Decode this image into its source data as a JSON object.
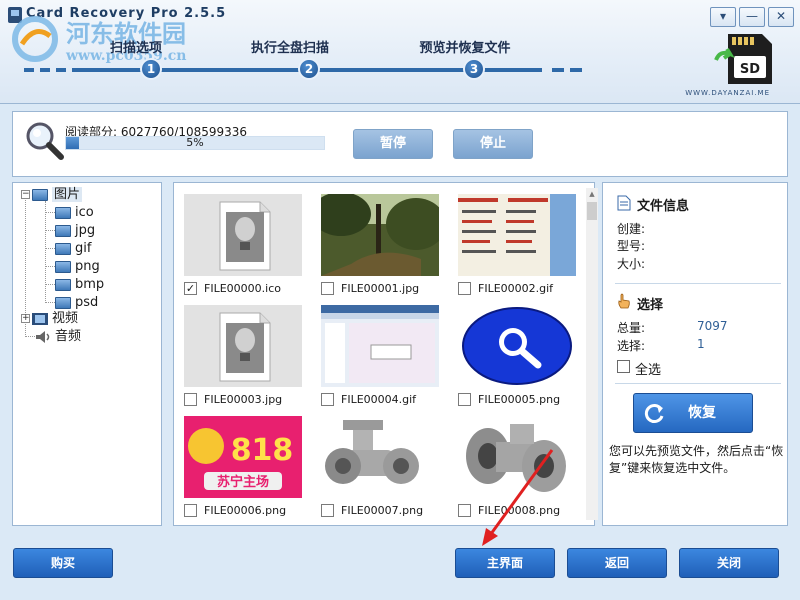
{
  "app": {
    "title": "Card Recovery Pro 2.5.5",
    "watermark_line1": "河东软件园",
    "watermark_line2": "www.pc0359.cn",
    "brand_site": "WWW.DAYANZAI.ME",
    "sd_label": "SD"
  },
  "window_controls": {
    "menu": "▾",
    "minimize": "—",
    "close": "✕"
  },
  "steps": [
    {
      "number": "1",
      "label": "扫描选项"
    },
    {
      "number": "2",
      "label": "执行全盘扫描"
    },
    {
      "number": "3",
      "label": "预览并恢复文件"
    }
  ],
  "scan": {
    "read_label": "阅读部分: 6027760/108599336",
    "progress_text": "5%",
    "progress_value": 0.05,
    "pause_label": "暂停",
    "stop_label": "停止"
  },
  "tree": {
    "root": {
      "label": "图片",
      "expander": "−",
      "icon": "folder-icon"
    },
    "children": [
      "ico",
      "jpg",
      "gif",
      "png",
      "bmp",
      "psd"
    ],
    "video": {
      "label": "视频",
      "expander": "+",
      "icon": "video-icon"
    },
    "audio": {
      "label": "音频",
      "icon": "speaker-icon"
    }
  },
  "files": [
    {
      "name": "FILE00000.ico",
      "checked": true,
      "thumb": "photo-placeholder-icon"
    },
    {
      "name": "FILE00001.jpg",
      "checked": false,
      "thumb": "forest-photo"
    },
    {
      "name": "FILE00002.gif",
      "checked": false,
      "thumb": "document-screenshot"
    },
    {
      "name": "FILE00003.jpg",
      "checked": false,
      "thumb": "photo-placeholder-icon"
    },
    {
      "name": "FILE00004.gif",
      "checked": false,
      "thumb": "software-screenshot"
    },
    {
      "name": "FILE00005.png",
      "checked": false,
      "thumb": "magnifier-logo"
    },
    {
      "name": "FILE00006.png",
      "checked": false,
      "thumb": "suning-818-banner"
    },
    {
      "name": "FILE00007.png",
      "checked": false,
      "thumb": "pipe-fitting"
    },
    {
      "name": "FILE00008.png",
      "checked": false,
      "thumb": "pipe-fitting"
    }
  ],
  "banner_text": {
    "big": "818",
    "sub": "苏宁主场"
  },
  "checkmark": "✓",
  "info": {
    "file_info_title": "文件信息",
    "created_label": "创建:",
    "type_label": "型号:",
    "size_label": "大小:",
    "select_title": "选择",
    "total_label": "总量:",
    "total_value": "7097",
    "selected_label": "选择:",
    "selected_value": "1",
    "select_all_label": "全选",
    "restore_label": "恢复",
    "hint": "您可以先预览文件，然后点击“恢复”键来恢复选中文件。"
  },
  "footer": {
    "buy_label": "购买",
    "home_label": "主界面",
    "back_label": "返回",
    "close_label": "关闭"
  },
  "colors": {
    "accent": "#2568c1",
    "progress": "#2f6db3",
    "annotation_arrow": "#e02020"
  }
}
